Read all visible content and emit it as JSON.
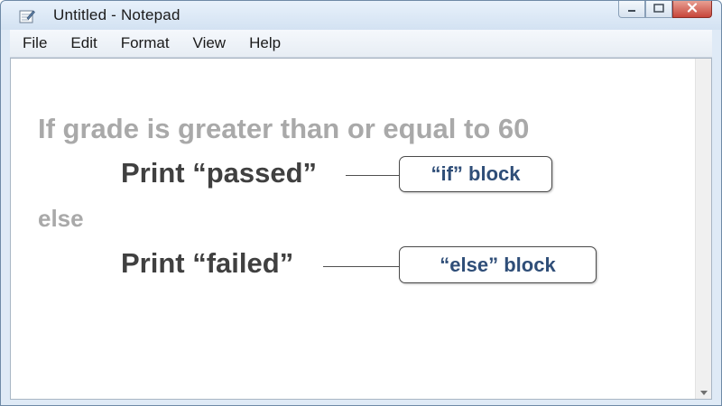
{
  "window": {
    "title": "Untitled - Notepad",
    "app_icon": "notepad-icon",
    "controls": [
      "minimize-icon",
      "maximize-icon",
      "close-icon"
    ]
  },
  "menu": {
    "items": [
      {
        "label": "File"
      },
      {
        "label": "Edit"
      },
      {
        "label": "Format"
      },
      {
        "label": "View"
      },
      {
        "label": "Help"
      }
    ]
  },
  "editor": {
    "lines": {
      "condition": "If grade is greater than or equal to 60",
      "print_passed": "Print “passed”",
      "else": "else",
      "print_failed": "Print “failed”"
    },
    "callouts": {
      "if_block": "“if” block",
      "else_block": "“else” block"
    }
  },
  "colors": {
    "callout_text": "#2f4e78",
    "dim_text": "#a9a9a9",
    "dark_text": "#404040"
  }
}
